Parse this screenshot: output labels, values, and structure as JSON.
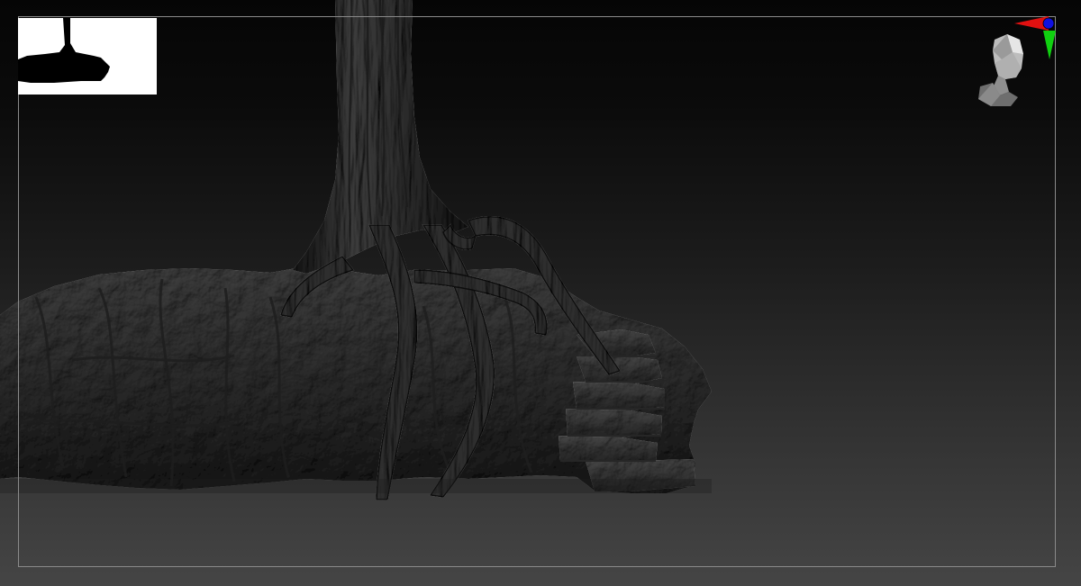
{
  "viewport": {
    "background_top": "#050505",
    "background_bottom": "#454545",
    "frame_color": "#8a8a8a"
  },
  "sculpt": {
    "material_color": "#4a4a4a",
    "highlight_color": "#7a7a7a",
    "shadow_color": "#1a1a1a"
  },
  "thumbnail": {
    "background": "#ffffff",
    "silhouette": "#000000"
  },
  "gizmo": {
    "x_axis_color": "#e01010",
    "y_axis_color": "#10d010",
    "z_axis_color": "#1010e0",
    "icon": "axis-orientation-icon"
  },
  "navigation": {
    "icon": "head-navigation-icon"
  }
}
